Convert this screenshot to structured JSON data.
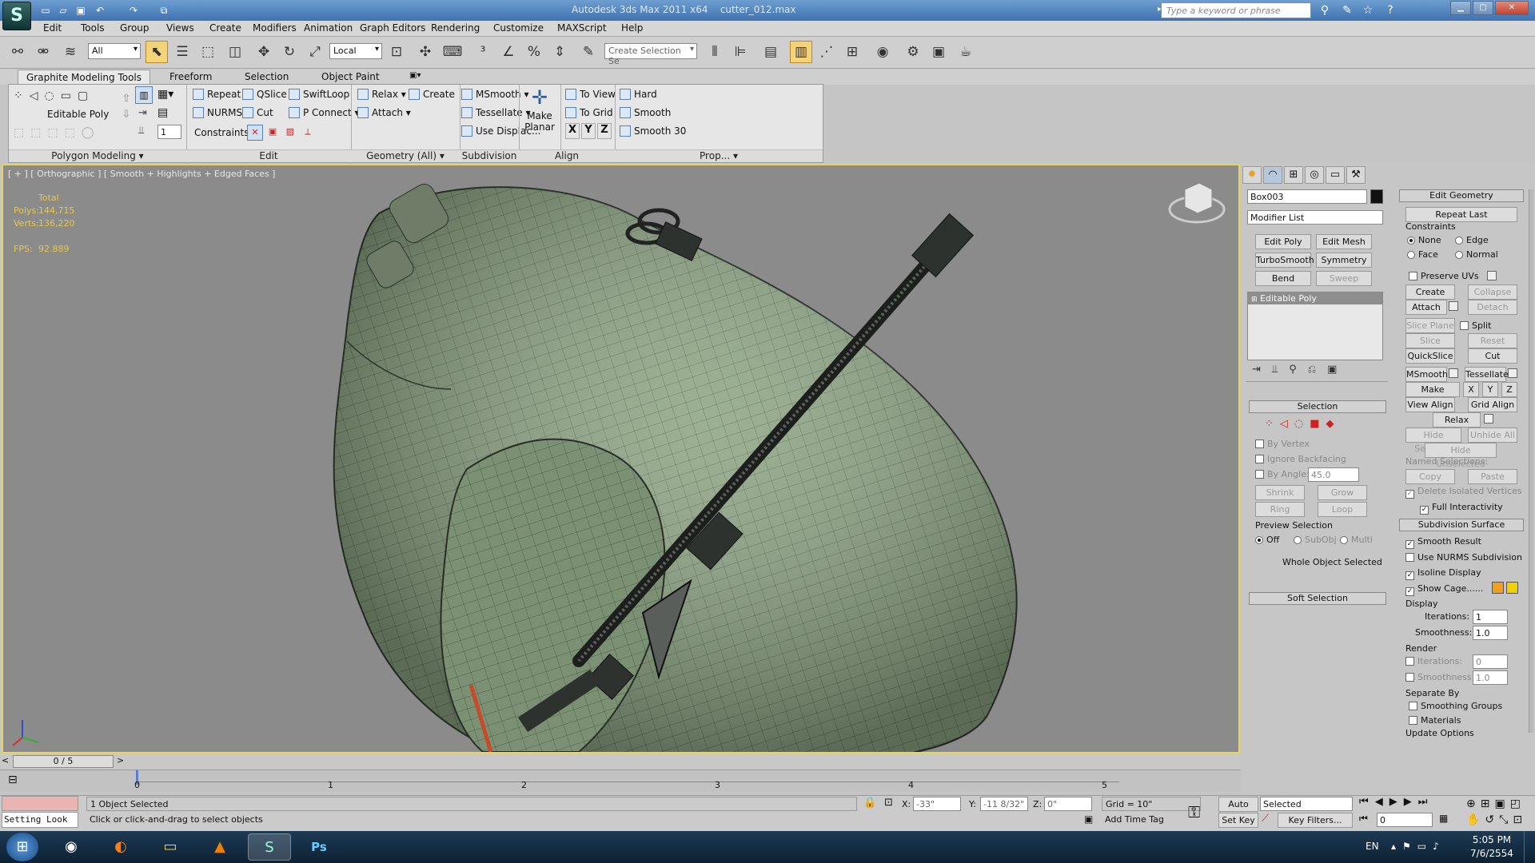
{
  "title": {
    "app": "Autodesk 3ds Max  2011 x64",
    "file": "cutter_012.max",
    "search_placeholder": "Type a keyword or phrase"
  },
  "menu": [
    "Edit",
    "Tools",
    "Group",
    "Views",
    "Create",
    "Modifiers",
    "Animation",
    "Graph Editors",
    "Rendering",
    "Customize",
    "MAXScript",
    "Help"
  ],
  "toolbar": {
    "filter": "All",
    "coord": "Local",
    "selection_set": "Create Selection Se"
  },
  "ribbon": {
    "tabs": [
      "Graphite Modeling Tools",
      "Freeform",
      "Selection",
      "Object Paint"
    ],
    "editable_poly": "Editable Poly",
    "edit": [
      "Repeat",
      "QSlice",
      "SwiftLoop",
      "NURMS",
      "Cut",
      "P Connect"
    ],
    "constraints_label": "Constraints:",
    "spinner": "1",
    "geometry": [
      "Relax",
      "Create",
      "Attach"
    ],
    "subdivision": [
      "MSmooth",
      "Tessellate",
      "Use Displac..."
    ],
    "make_planar": "Make Planar",
    "align": [
      "To View",
      "To Grid",
      "X",
      "Y",
      "Z"
    ],
    "props": [
      "Hard",
      "Smooth",
      "Smooth 30"
    ],
    "panels": [
      "Polygon Modeling ▾",
      "Edit",
      "Geometry (All) ▾",
      "Subdivision",
      "Align",
      "Prop... ▾"
    ]
  },
  "viewport": {
    "label": "[ + ] [ Orthographic ] [ Smooth + Highlights + Edged Faces ]",
    "stats": {
      "total": "Total",
      "polys_label": "Polys:",
      "polys": "144,715",
      "verts_label": "Verts:",
      "verts": "136,220",
      "fps_label": "FPS:",
      "fps": "92.889"
    }
  },
  "cmd": {
    "object_name": "Box003",
    "modifier_list": "Modifier List",
    "modifier_buttons": [
      "Edit Poly",
      "Edit Mesh",
      "TurboSmooth",
      "Symmetry",
      "Bend",
      "Sweep"
    ],
    "stack_item": "Editable Poly",
    "selection": {
      "title": "Selection",
      "by_vertex": "By Vertex",
      "ignore_backfacing": "Ignore Backfacing",
      "by_angle": "By Angle:",
      "angle": "45.0",
      "shrink": "Shrink",
      "grow": "Grow",
      "ring": "Ring",
      "loop": "Loop",
      "preview": "Preview Selection",
      "off": "Off",
      "subobj": "SubObj",
      "multi": "Multi",
      "status": "Whole Object Selected"
    },
    "soft_selection": "Soft Selection",
    "edit_geometry": {
      "title": "Edit Geometry",
      "repeat_last": "Repeat Last",
      "constraints": "Constraints",
      "none": "None",
      "edge": "Edge",
      "face": "Face",
      "normal": "Normal",
      "preserve_uvs": "Preserve UVs",
      "create": "Create",
      "collapse": "Collapse",
      "attach": "Attach",
      "detach": "Detach",
      "slice_plane": "Slice Plane",
      "split": "Split",
      "slice": "Slice",
      "reset_plane": "Reset Plane",
      "quickslice": "QuickSlice",
      "cut": "Cut",
      "msmooth": "MSmooth",
      "tessellate": "Tessellate",
      "make_planar": "Make Planar",
      "x": "X",
      "y": "Y",
      "z": "Z",
      "view_align": "View Align",
      "grid_align": "Grid Align",
      "relax": "Relax",
      "hide_selected": "Hide Selected",
      "unhide_all": "Unhide All",
      "hide_unselected": "Hide Unselected",
      "named_selections": "Named Selections:",
      "copy": "Copy",
      "paste": "Paste",
      "delete_isolated": "Delete Isolated Vertices",
      "full_interactivity": "Full Interactivity"
    },
    "subdivision_surface": {
      "title": "Subdivision Surface",
      "smooth_result": "Smooth Result",
      "use_nurms": "Use NURMS Subdivision",
      "isoline": "Isoline Display",
      "show_cage": "Show Cage......",
      "display": "Display",
      "iterations": "Iterations:",
      "smoothness": "Smoothness:",
      "display_iterations": "1",
      "display_smoothness": "1.0",
      "render": "Render",
      "render_iterations": "0",
      "render_smoothness": "1.0",
      "separate_by": "Separate By",
      "smoothing_groups": "Smoothing Groups",
      "materials": "Materials",
      "update_options": "Update Options"
    }
  },
  "timeline": {
    "frame": "0 / 5",
    "ticks": [
      "0",
      "1",
      "2",
      "3",
      "4",
      "5"
    ]
  },
  "status": {
    "script": "Setting Look",
    "selected": "1 Object Selected",
    "prompt": "Click or click-and-drag to select objects",
    "x_label": "X:",
    "x": "-33\"",
    "y_label": "Y:",
    "y": "-11 8/32\"",
    "z_label": "Z:",
    "z": "0\"",
    "grid": "Grid = 10\"",
    "add_time_tag": "Add Time Tag",
    "auto_key": "Auto Key",
    "key_mode": "Selected",
    "set_key": "Set Key",
    "key_filters": "Key Filters...",
    "frame": "0"
  },
  "taskbar": {
    "lang": "EN",
    "time": "5:05 PM",
    "date": "7/6/2554"
  },
  "colors": {
    "accent_yellow": "#e8d65a",
    "cage_1": "#f0a020",
    "cage_2": "#f2d000",
    "mesh": "#8ea584"
  }
}
